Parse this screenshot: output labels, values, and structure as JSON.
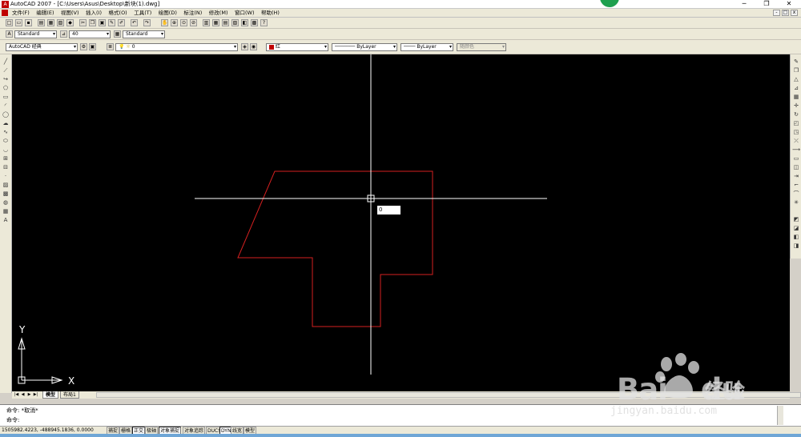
{
  "window": {
    "title": "AutoCAD 2007 - [C:\\Users\\Asus\\Desktop\\新块(1).dwg]",
    "minimize": "─",
    "restore": "❐",
    "close": "✕"
  },
  "menu": {
    "items": [
      "文件(F)",
      "编辑(E)",
      "视图(V)",
      "插入(I)",
      "格式(O)",
      "工具(T)",
      "绘图(D)",
      "标注(N)",
      "修改(M)",
      "窗口(W)",
      "帮助(H)"
    ],
    "mdi_minimize": "-",
    "mdi_restore": "□",
    "mdi_close": "x"
  },
  "styles_toolbar": {
    "text_style": "Standard",
    "dim_style": "40",
    "table_style": "Standard"
  },
  "workspace_toolbar": {
    "workspace": "AutoCAD 经典",
    "layer": "0",
    "color": "红",
    "linetype": "ByLayer",
    "lineweight": "ByLayer",
    "plot_style": "随颜色"
  },
  "colors": {
    "accent_red": "#c00000",
    "drawing_line": "#d42020",
    "crosshair": "#ffffff",
    "canvas_bg": "#000000"
  },
  "canvas": {
    "dynamic_input": "0",
    "ucs_x_label": "X",
    "ucs_y_label": "Y"
  },
  "layout_tabs": {
    "nav": [
      "|◀",
      "◀",
      "▶",
      "▶|"
    ],
    "tabs": [
      "模型",
      "布局1"
    ]
  },
  "command_line": {
    "history": "命令: *取消*",
    "prompt": "命令:"
  },
  "status": {
    "coordinates": "1505982.4223, -488945.1836, 0.0000",
    "buttons": [
      "捕捉",
      "栅格",
      "正交",
      "极轴",
      "对象捕捉",
      "对象追踪",
      "DUCS",
      "DYN",
      "线宽",
      "模型"
    ],
    "active": [
      "正交",
      "对象捕捉",
      "DYN"
    ]
  },
  "watermark": {
    "brand": "Bai",
    "brand_du": "du",
    "brand_cn": "经验",
    "url": "jingyan.baidu.com"
  }
}
